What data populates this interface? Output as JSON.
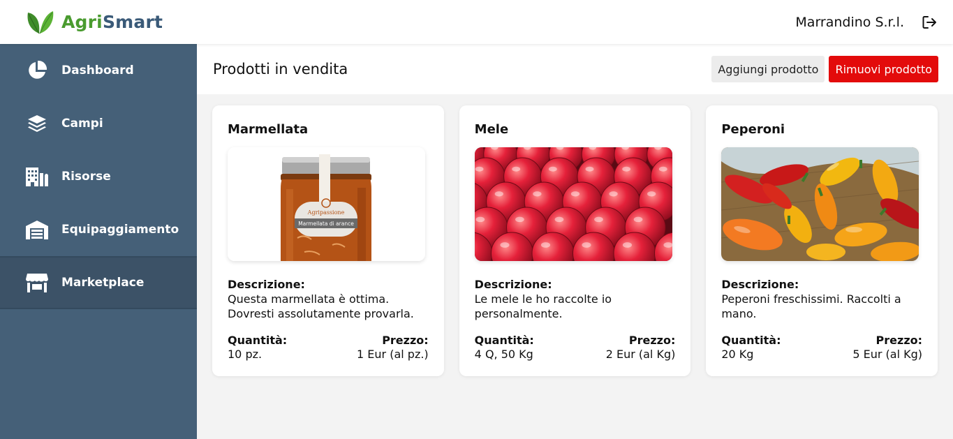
{
  "brand": {
    "part1": "Agri",
    "part2": "Smart"
  },
  "user": {
    "company": "Marrandino S.r.l."
  },
  "sidebar": {
    "items": [
      {
        "label": "Dashboard",
        "icon": "pie-chart-icon"
      },
      {
        "label": "Campi",
        "icon": "layers-icon"
      },
      {
        "label": "Risorse",
        "icon": "buildings-icon"
      },
      {
        "label": "Equipaggiamento",
        "icon": "warehouse-icon"
      },
      {
        "label": "Marketplace",
        "icon": "store-icon",
        "active": true
      }
    ]
  },
  "main": {
    "title": "Prodotti in vendita",
    "add_label": "Aggiungi prodotto",
    "remove_label": "Rimuovi prodotto"
  },
  "labels": {
    "description": "Descrizione:",
    "quantity": "Quantità:",
    "price": "Prezzo:"
  },
  "products": [
    {
      "name": "Marmellata",
      "description": "Questa marmellata è ottima. Dovresti assolutamente provarla.",
      "quantity": "10 pz.",
      "price": "1 Eur (al pz.)",
      "jar_brand": "Agripassione",
      "jar_label": "Marmellata di arance"
    },
    {
      "name": "Mele",
      "description": "Le mele le ho raccolte io personalmente.",
      "quantity": "4 Q, 50 Kg",
      "price": "2 Eur (al Kg)"
    },
    {
      "name": "Peperoni",
      "description": "Peperoni freschissimi. Raccolti a mano.",
      "quantity": "20 Kg",
      "price": "5 Eur (al Kg)"
    }
  ],
  "colors": {
    "sidebar": "#456078",
    "sidebar_active": "#3c5267",
    "brand_green": "#4a9b2f",
    "brand_blue": "#3a5a78",
    "remove_red": "#e30b0b"
  }
}
